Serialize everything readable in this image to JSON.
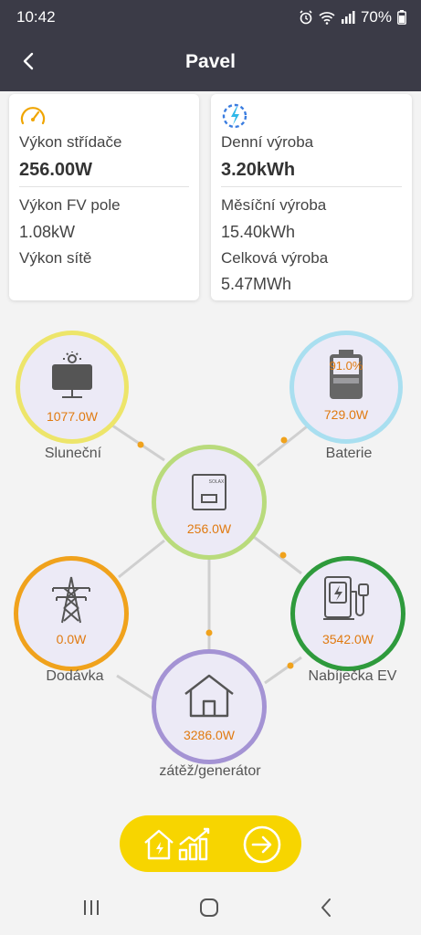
{
  "status": {
    "time": "10:42",
    "battery": "70%"
  },
  "header": {
    "title": "Pavel"
  },
  "left_card": {
    "inverter_label": "Výkon střídače",
    "inverter_value": "256.00W",
    "pv_label": "Výkon FV pole",
    "pv_value": "1.08kW",
    "grid_label": "Výkon sítě"
  },
  "right_card": {
    "daily_label": "Denní výroba",
    "daily_value": "3.20kWh",
    "monthly_label": "Měsíční výroba",
    "monthly_value": "15.40kWh",
    "total_label": "Celková výroba",
    "total_value": "5.47MWh"
  },
  "flow": {
    "solar": {
      "value": "1077.0W",
      "label": "Sluneční"
    },
    "battery": {
      "value": "729.0W",
      "soc": "91.0%",
      "label": "Baterie"
    },
    "inverter": {
      "value": "256.0W",
      "brand": "SOLAX"
    },
    "grid": {
      "value": "0.0W",
      "label": "Dodávka"
    },
    "ev": {
      "value": "3542.0W",
      "label": "Nabíječka EV"
    },
    "load": {
      "value": "3286.0W",
      "label": "zátěž/generátor"
    }
  },
  "colors": {
    "header_bg": "#3b3b47",
    "accent_orange": "#e07a10",
    "solar_ring": "#ede56a",
    "battery_ring": "#a9dff0",
    "inverter_ring": "#b9db7c",
    "grid_ring": "#f0a21c",
    "ev_ring": "#2e9a3c",
    "load_ring": "#a493d4",
    "cta_bg": "#f7d500"
  }
}
